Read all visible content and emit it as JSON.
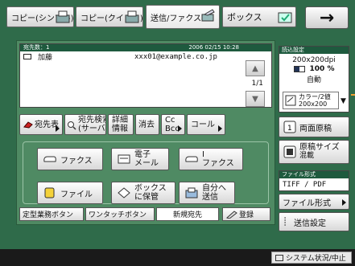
{
  "tabs": [
    {
      "label": "コピー(シンプル)",
      "icon": "copy-icon"
    },
    {
      "label": "コピー(クイック)",
      "icon": "copy-icon"
    },
    {
      "label": "送信/ファクス",
      "icon": "send-fax-icon",
      "active": true
    },
    {
      "label": "ボックス",
      "icon": "box-icon"
    }
  ],
  "next_button": "→",
  "destinations": {
    "count_label": "宛先数：1",
    "datetime": "2006 02/15 10:28",
    "rows": [
      {
        "name": "加藤",
        "address": "xxx01@example.co.jp"
      }
    ],
    "page": "1/1"
  },
  "actions": {
    "address_book": "宛先表",
    "address_search_line1": "宛先検索",
    "address_search_line2": "(サーバ)",
    "detail_line1": "詳細",
    "detail_line2": "情報",
    "delete": "消去",
    "cc_line1": "Cc",
    "cc_line2": "Bcc",
    "call": "コール"
  },
  "send_types": [
    {
      "id": "fax",
      "label": "ファクス",
      "icon": "fax-icon"
    },
    {
      "id": "email",
      "line1": "電子",
      "line2": "メール",
      "icon": "email-icon"
    },
    {
      "id": "ifax",
      "line1": "I",
      "line2": "ファクス",
      "icon": "ifax-icon"
    },
    {
      "id": "file",
      "label": "ファイル",
      "icon": "file-icon"
    },
    {
      "id": "box",
      "line1": "ボックス",
      "line2": "に保管",
      "icon": "box-store-icon"
    },
    {
      "id": "self",
      "line1": "自分へ",
      "line2": "送信",
      "icon": "send-self-icon"
    }
  ],
  "bottom_tabs": {
    "favorites": "定型業務ボタン",
    "one_touch": "ワンタッチボタン",
    "new_dest": "新規宛先",
    "register": "登録"
  },
  "scan_settings": {
    "header": "読込設定",
    "resolution": "200x200dpi",
    "zoom": "100 %",
    "mode": "自動",
    "color_line1": "カラー/2値",
    "color_line2": "200x200"
  },
  "right_buttons": {
    "duplex": "両面原稿",
    "doc_size_line1": "原稿サイズ",
    "doc_size_line2": "混載",
    "file_format_header": "ファイル形式",
    "file_format_value": "TIFF / PDF",
    "file_format_button": "ファイル形式",
    "send_settings": "送信設定"
  },
  "status": {
    "label": "システム状況/中止"
  },
  "colors": {
    "background": "#2f6b4a",
    "panel": "#4f8a63",
    "header": "#1e5a3e",
    "accent": "#f0a030"
  }
}
